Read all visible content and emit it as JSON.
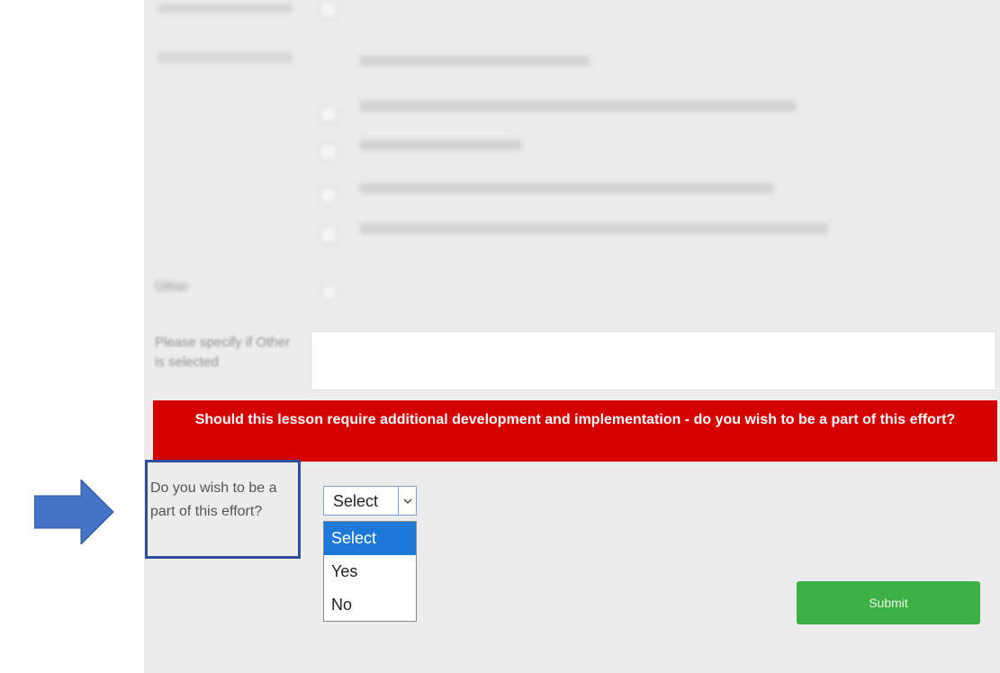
{
  "colors": {
    "banner_bg": "#d40000",
    "submit_bg": "#3cb045",
    "highlight_border": "#2f4f9e",
    "arrow_fill": "#4472c4",
    "selected_option_bg": "#1e78d7"
  },
  "blurred_section": {
    "other_label": "Other",
    "specify_label": "Please specify if Other is selected"
  },
  "banner": {
    "text": "Should this lesson require additional development and implementation - do you wish to be a part of this effort?"
  },
  "question": {
    "label": "Do you wish to be a part of this effort?"
  },
  "select": {
    "current_value": "Select",
    "options": [
      "Select",
      "Yes",
      "No"
    ],
    "highlighted_option": "Select"
  },
  "submit": {
    "label": "Submit"
  },
  "icons": {
    "pointer": "right-arrow-icon",
    "select_toggle": "chevron-down-icon"
  }
}
